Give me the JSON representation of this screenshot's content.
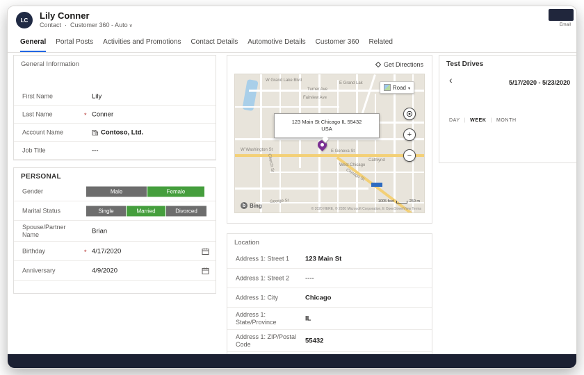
{
  "header": {
    "avatar_initials": "LC",
    "name": "Lily Conner",
    "entity": "Contact",
    "form_name": "Customer 360 - Auto",
    "email_label": "Email"
  },
  "tabs": [
    {
      "label": "General",
      "active": true
    },
    {
      "label": "Portal Posts",
      "active": false
    },
    {
      "label": "Activities and Promotions",
      "active": false
    },
    {
      "label": "Contact Details",
      "active": false
    },
    {
      "label": "Automotive Details",
      "active": false
    },
    {
      "label": "Customer 360",
      "active": false
    },
    {
      "label": "Related",
      "active": false
    }
  ],
  "general_info": {
    "title": "General Information",
    "fields": [
      {
        "label": "First Name",
        "value": "Lily",
        "required": false
      },
      {
        "label": "Last Name",
        "value": "Conner",
        "required": true
      },
      {
        "label": "Account Name",
        "value": "Contoso, Ltd.",
        "required": false,
        "icon": "building-icon"
      },
      {
        "label": "Job Title",
        "value": "---",
        "required": false
      }
    ]
  },
  "personal": {
    "title": "PERSONAL",
    "gender": {
      "label": "Gender",
      "options": [
        "Male",
        "Female"
      ],
      "selected": "Female"
    },
    "marital_status": {
      "label": "Marital Status",
      "options": [
        "Single",
        "Married",
        "Divorced"
      ],
      "selected": "Married"
    },
    "spouse": {
      "label": "Spouse/Partner Name",
      "value": "Brian"
    },
    "birthday": {
      "label": "Birthday",
      "value": "4/17/2020",
      "required": true,
      "icon": "calendar-icon"
    },
    "anniversary": {
      "label": "Anniversary",
      "value": "4/9/2020",
      "required": false,
      "icon": "calendar-icon"
    }
  },
  "map_panel": {
    "get_directions": "Get Directions",
    "view_mode": "Road",
    "tooltip_line1": "123 Main St Chicago IL 55432",
    "tooltip_line2": "USA",
    "zoom_in": "+",
    "zoom_out": "−",
    "bing_icon_letter": "b",
    "bing_label": "Bing",
    "scale_feet": "1005 feet",
    "scale_meters": "250 m",
    "copyright": "© 2020 HERE, © 2020 Microsoft Corporation, E OpenStreetView Terms",
    "street_labels": [
      "W Grand Lake Blvd",
      "Turner Ave",
      "Fairview Ave",
      "E Grand Lak",
      "W Washington St",
      "Church St",
      "E Geneva St",
      "West Chicago",
      "Cathlynd",
      "Chicago St",
      "George St"
    ]
  },
  "location": {
    "title": "Location",
    "fields": [
      {
        "label": "Address 1: Street 1",
        "value": "123 Main St"
      },
      {
        "label": "Address 1: Street 2",
        "value": "----"
      },
      {
        "label": "Address 1: City",
        "value": "Chicago"
      },
      {
        "label": "Address 1: State/Province",
        "value": "IL"
      },
      {
        "label": "Address 1: ZIP/Postal Code",
        "value": "55432"
      }
    ]
  },
  "test_drives": {
    "title": "Test Drives",
    "date_range": "5/17/2020 - 5/23/2020",
    "views": [
      "DAY",
      "WEEK",
      "MONTH"
    ],
    "selected_view": "WEEK"
  },
  "colors": {
    "accent_blue": "#2266E3",
    "option_green": "#459E3D",
    "option_gray": "#6D6D6D",
    "pin_purple": "#7B2F93",
    "footer_dark": "#1B2032"
  }
}
